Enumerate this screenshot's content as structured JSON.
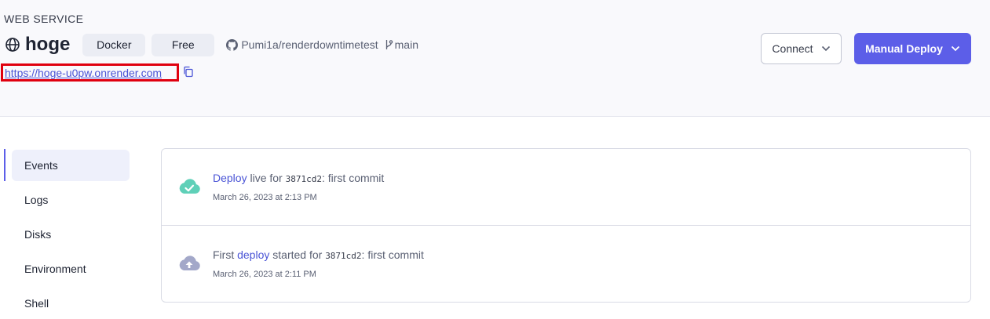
{
  "header": {
    "service_type": "WEB SERVICE",
    "service_name": "hoge",
    "badges": {
      "docker": "Docker",
      "plan": "Free"
    },
    "repo": "Pumi1a/renderdowntimetest",
    "branch": "main",
    "url": "https://hoge-u0pw.onrender.com",
    "connect_label": "Connect",
    "deploy_label": "Manual Deploy",
    "accent_color": "#5c5ee8",
    "highlight_color": "#e0000f"
  },
  "sidebar": {
    "items": [
      {
        "label": "Events",
        "active": true
      },
      {
        "label": "Logs",
        "active": false
      },
      {
        "label": "Disks",
        "active": false
      },
      {
        "label": "Environment",
        "active": false
      },
      {
        "label": "Shell",
        "active": false
      }
    ]
  },
  "events": [
    {
      "icon": "cloud-check-icon",
      "prefix": "",
      "link": "Deploy",
      "mid": " live for ",
      "sha": "3871cd2",
      "sep": ":",
      "message": " first commit",
      "time": "March 26, 2023 at 2:13 PM"
    },
    {
      "icon": "cloud-upload-icon",
      "prefix": "First ",
      "link": "deploy",
      "mid": " started for ",
      "sha": "3871cd2",
      "sep": ":",
      "message": " first commit",
      "time": "March 26, 2023 at 2:11 PM"
    }
  ]
}
